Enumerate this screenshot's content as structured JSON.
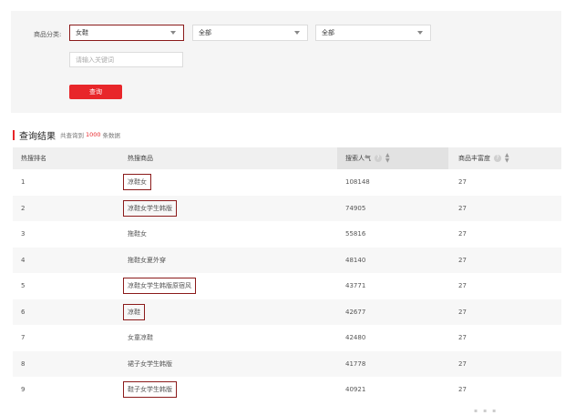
{
  "filter": {
    "category_label": "商品分类:",
    "category_1": "女鞋",
    "category_2": "全部",
    "category_3": "全部",
    "keyword_placeholder": "请输入关键词",
    "query_button": "查询"
  },
  "result": {
    "title": "查询结果",
    "prefix": "共查询到",
    "count": "1000",
    "suffix": "条数据"
  },
  "table": {
    "headers": {
      "rank": "热搜排名",
      "product": "热搜商品",
      "popularity": "搜索人气",
      "richness": "商品丰富度"
    },
    "rows": [
      {
        "rank": "1",
        "product": "凉鞋女",
        "popularity": "108148",
        "richness": "27"
      },
      {
        "rank": "2",
        "product": "凉鞋女学生韩版",
        "popularity": "74905",
        "richness": "27"
      },
      {
        "rank": "3",
        "product": "拖鞋女",
        "popularity": "55816",
        "richness": "27"
      },
      {
        "rank": "4",
        "product": "拖鞋女夏外穿",
        "popularity": "48140",
        "richness": "27"
      },
      {
        "rank": "5",
        "product": "凉鞋女学生韩版原宿风",
        "popularity": "43771",
        "richness": "27"
      },
      {
        "rank": "6",
        "product": "凉鞋",
        "popularity": "42677",
        "richness": "27"
      },
      {
        "rank": "7",
        "product": "女童凉鞋",
        "popularity": "42480",
        "richness": "27"
      },
      {
        "rank": "8",
        "product": "裙子女学生韩版",
        "popularity": "41778",
        "richness": "27"
      },
      {
        "rank": "9",
        "product": "鞋子女学生韩版",
        "popularity": "40921",
        "richness": "27"
      }
    ]
  },
  "icons": {
    "help": "question-circle-icon",
    "sort": "sort-icon",
    "dropdown": "chevron-down-icon"
  },
  "colors": {
    "accent": "#e8262a",
    "highlight_box": "#8b1a1a"
  }
}
